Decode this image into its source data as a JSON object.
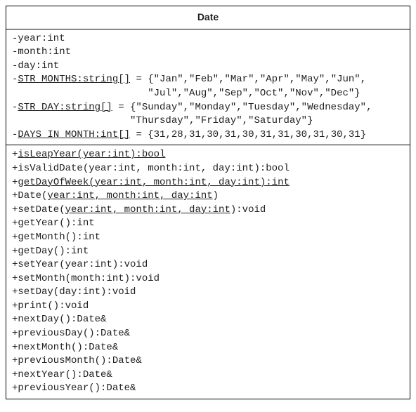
{
  "className": "Date",
  "attributes": {
    "a1": "-year:int",
    "a2": "-month:int",
    "a3": "-day:int",
    "a4": {
      "pre": "-",
      "u": "STR MONTHS:string[]",
      "post": " = {\"Jan\",\"Feb\",\"Mar\",\"Apr\",\"May\",\"Jun\","
    },
    "a4b": "                       \"Jul\",\"Aug\",\"Sep\",\"Oct\",\"Nov\",\"Dec\"}",
    "a5": {
      "pre": "-",
      "u": "STR DAY:string[]",
      "post": " = {\"Sunday\",\"Monday\",\"Tuesday\",\"Wednesday\","
    },
    "a5b": "                    \"Thursday\",\"Friday\",\"Saturday\"}",
    "a6": {
      "pre": "-",
      "u": "DAYS IN MONTH:int[]",
      "post": " = {31,28,31,30,31,30,31,31,30,31,30,31}"
    }
  },
  "methods": {
    "m1": {
      "pre": "+",
      "u": "isLeapYear(year:int):bool"
    },
    "m2": "+isValidDate(year:int, month:int, day:int):bool",
    "m3": {
      "pre": "+",
      "u": "getDayOfWeek(year:int, month:int, day:int):int"
    },
    "m4": {
      "pre": "+Date(",
      "u": "year:int, month:int, day:int",
      "post": ")"
    },
    "m5": {
      "pre": "+setDate(",
      "u": "year:int, month:int, day:int",
      "post": "):void"
    },
    "m6": "+getYear():int",
    "m7": "+getMonth():int",
    "m8": "+getDay():int",
    "m9": "+setYear(year:int):void",
    "m10": "+setMonth(month:int):void",
    "m11": "+setDay(day:int):void",
    "m12": "+print():void",
    "m13": "+nextDay():Date&",
    "m14": "+previousDay():Date&",
    "m15": "+nextMonth():Date&",
    "m16": "+previousMonth():Date&",
    "m17": "+nextYear():Date&",
    "m18": "+previousYear():Date&"
  }
}
